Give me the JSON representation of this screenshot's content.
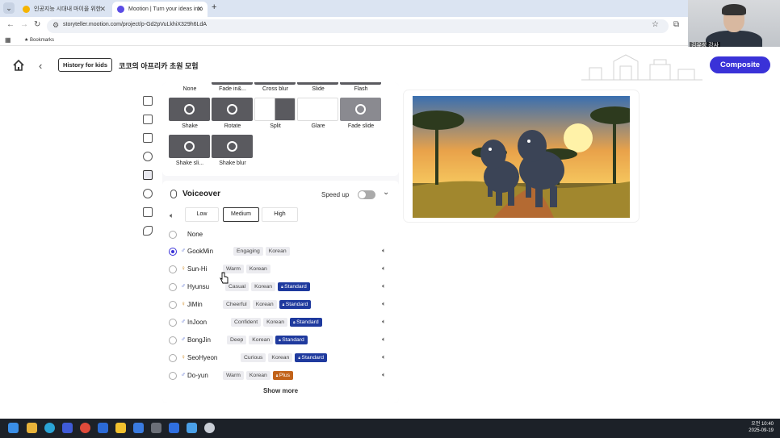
{
  "browser": {
    "tabs": [
      {
        "title": "인공지능 시대내 마이을 위한",
        "close": "✕"
      },
      {
        "title": "Mootion | Turn your ideas into",
        "close": "✕"
      }
    ],
    "new_tab": "+",
    "url": "storyteller.mootion.com/project/p-Gd2pVuLkhiX329h6LdA",
    "bookmarks_label": "Bookmarks"
  },
  "webcam": {
    "label": "김유성 강사"
  },
  "header": {
    "history_button": "History for kids",
    "project_title": "코코의 아프리카 초원 모험",
    "composite_button": "Composite"
  },
  "transitions": {
    "row0": [
      "None",
      "Fade in&...",
      "Cross blur",
      "Slide",
      "Flash"
    ],
    "row1": [
      "Shake",
      "Rotate",
      "Split",
      "Glare",
      "Fade slide"
    ],
    "row2": [
      "Shake sli...",
      "Shake blur"
    ]
  },
  "voiceover": {
    "title": "Voiceover",
    "speed_up_label": "Speed up",
    "volume_levels": [
      "Low",
      "Medium",
      "High"
    ],
    "selected_volume": "Medium",
    "none_option": "None",
    "voices": [
      {
        "gender": "♂",
        "name": "GookMin",
        "tags": [
          "Engaging",
          "Korean"
        ],
        "badge": "",
        "selected": true
      },
      {
        "gender": "♀",
        "name": "Sun-Hi",
        "tags": [
          "Warm",
          "Korean"
        ],
        "badge": "",
        "selected": false
      },
      {
        "gender": "♂",
        "name": "Hyunsu",
        "tags": [
          "Casual",
          "Korean"
        ],
        "badge": "Standard",
        "selected": false
      },
      {
        "gender": "♀",
        "name": "JiMin",
        "tags": [
          "Cheerful",
          "Korean"
        ],
        "badge": "Standard",
        "selected": false
      },
      {
        "gender": "♂",
        "name": "InJoon",
        "tags": [
          "Confident",
          "Korean"
        ],
        "badge": "Standard",
        "selected": false
      },
      {
        "gender": "♂",
        "name": "BongJin",
        "tags": [
          "Deep",
          "Korean"
        ],
        "badge": "Standard",
        "selected": false
      },
      {
        "gender": "♀",
        "name": "SeoHyeon",
        "tags": [
          "Curious",
          "Korean"
        ],
        "badge": "Standard",
        "selected": false
      },
      {
        "gender": "♂",
        "name": "Do-yun",
        "tags": [
          "Warm",
          "Korean"
        ],
        "badge": "Plus",
        "selected": false
      }
    ],
    "show_more": "Show more"
  },
  "taskbar": {
    "time": "오전 10:40",
    "date": "2025-09-19"
  },
  "colors": {
    "accent": "#3a32d8",
    "standard_badge": "#1f3a9e",
    "plus_badge": "#c2631a"
  }
}
